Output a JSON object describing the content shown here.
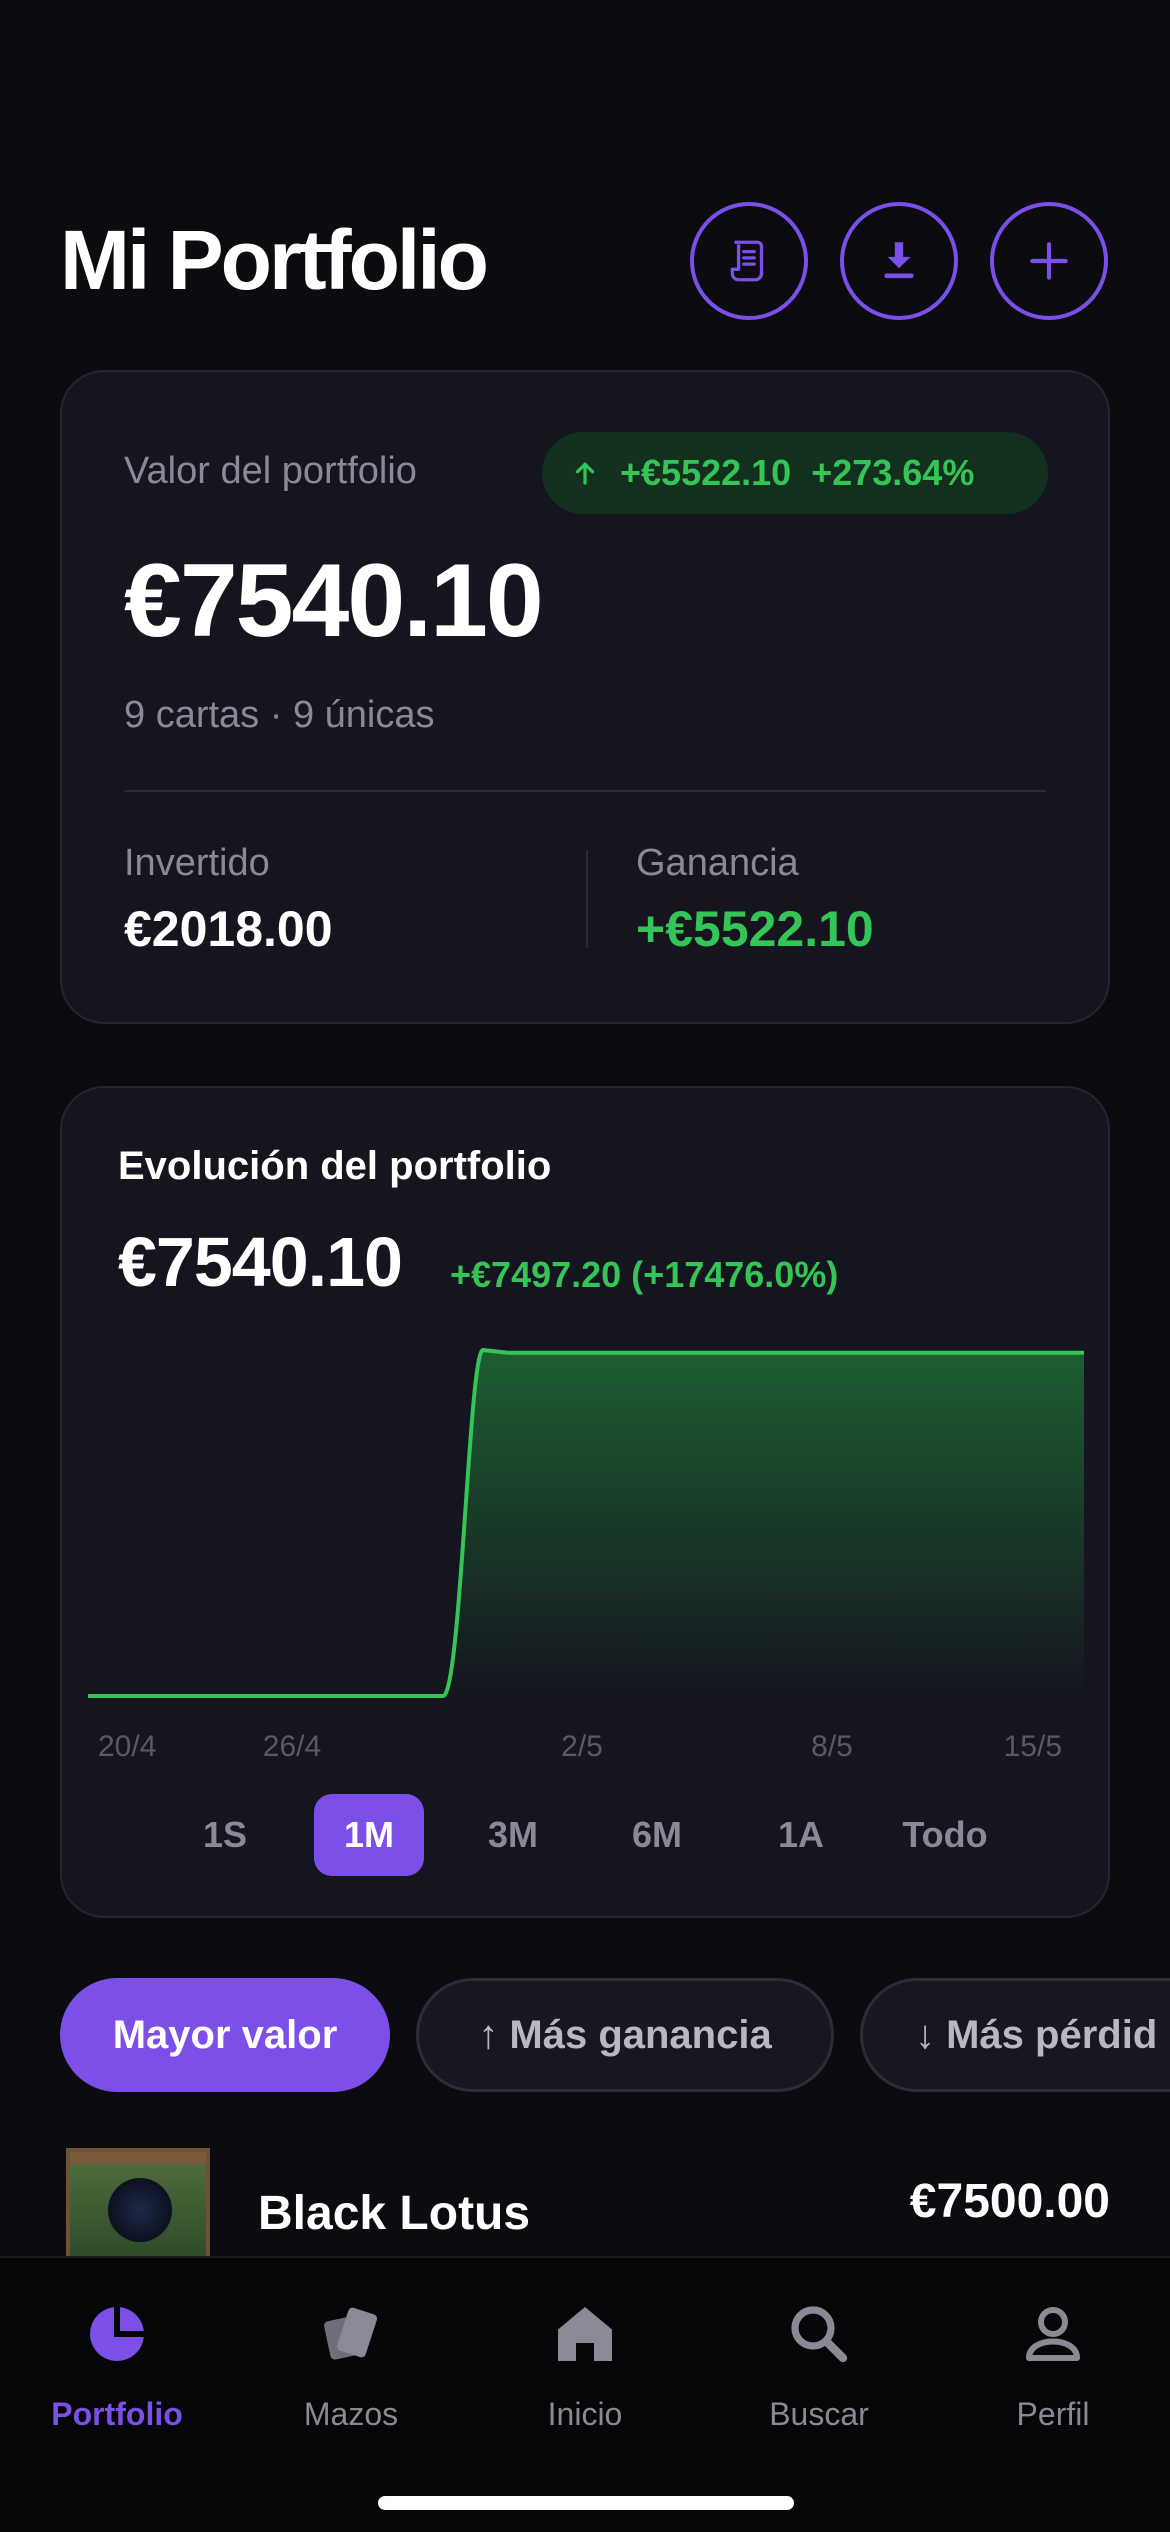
{
  "header": {
    "title": "Mi Portfolio",
    "buttons": [
      {
        "icon": "receipt-icon"
      },
      {
        "icon": "download-icon"
      },
      {
        "icon": "plus-icon"
      }
    ]
  },
  "summary": {
    "label": "Valor del portfolio",
    "badge_change": "+€5522.10",
    "badge_pct": "+273.64%",
    "value": "€7540.10",
    "sub": "9 cartas · 9 únicas",
    "invested_label": "Invertido",
    "invested_value": "€2018.00",
    "gain_label": "Ganancia",
    "gain_value": "+€5522.10"
  },
  "evolution": {
    "title": "Evolución del portfolio",
    "value": "€7540.10",
    "change": "+€7497.20 (+17476.0%)",
    "ranges": [
      "1S",
      "1M",
      "3M",
      "6M",
      "1A",
      "Todo"
    ],
    "active_range": "1M"
  },
  "chart_data": {
    "type": "area",
    "x_ticks": [
      "20/4",
      "26/4",
      "2/5",
      "8/5",
      "15/5"
    ],
    "x": [
      "16/4",
      "18/4",
      "20/4",
      "22/4",
      "24/4",
      "26/4",
      "28/4",
      "29/4",
      "30/4",
      "1/5",
      "2/5",
      "4/5",
      "6/5",
      "8/5",
      "10/5",
      "12/5",
      "14/5",
      "15/5"
    ],
    "values": [
      42.9,
      42.9,
      42.9,
      42.9,
      42.9,
      42.9,
      42.9,
      42.9,
      7600,
      7540.1,
      7540.1,
      7540.1,
      7540.1,
      7540.1,
      7540.1,
      7540.1,
      7540.1,
      7540.1
    ],
    "line_color": "#35c457",
    "grid": false
  },
  "filters": [
    {
      "label": "Mayor valor",
      "active": true
    },
    {
      "label": "↑ Más ganancia",
      "active": false
    },
    {
      "label": "↓ Más pérdid",
      "active": false
    }
  ],
  "list": [
    {
      "name": "Black Lotus",
      "price": "€7500.00"
    }
  ],
  "tabbar": [
    {
      "label": "Portfolio",
      "icon": "pie-chart-icon",
      "active": true
    },
    {
      "label": "Mazos",
      "icon": "cards-icon",
      "active": false
    },
    {
      "label": "Inicio",
      "icon": "home-icon",
      "active": false
    },
    {
      "label": "Buscar",
      "icon": "search-icon",
      "active": false
    },
    {
      "label": "Perfil",
      "icon": "person-icon",
      "active": false
    }
  ],
  "colors": {
    "accent": "#7b4fe8",
    "positive": "#35c457",
    "background": "#0b0b10",
    "card": "#15151f"
  }
}
